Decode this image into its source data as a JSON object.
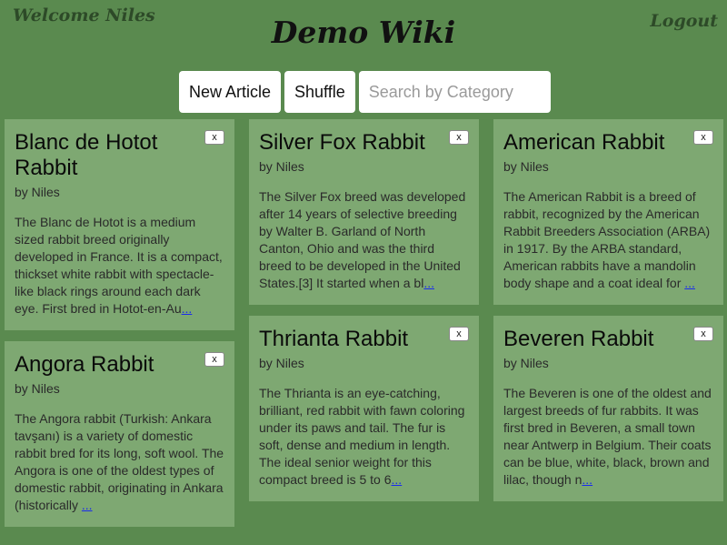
{
  "header": {
    "welcome": "Welcome Niles",
    "title": "Demo Wiki",
    "logout": "Logout"
  },
  "toolbar": {
    "new_article": "New Article",
    "shuffle": "Shuffle",
    "search_placeholder": "Search by Category"
  },
  "cards": [
    {
      "title": "Blanc de Hotot Rabbit",
      "author": "by Niles",
      "excerpt": "The Blanc de Hotot is a medium sized rabbit breed originally developed in France. It is a compact, thickset white rabbit with spectacle-like black rings around each dark eye. First bred in Hotot-en-Au",
      "more": "...",
      "close": "x"
    },
    {
      "title": "Silver Fox Rabbit",
      "author": "by Niles",
      "excerpt": "The Silver Fox breed was developed after 14 years of selective breeding by Walter B. Garland of North Canton, Ohio and was the third breed to be developed in the United States.[3] It started when a bl",
      "more": "...",
      "close": "x"
    },
    {
      "title": "American Rabbit",
      "author": "by Niles",
      "excerpt": "The American Rabbit is a breed of rabbit, recognized by the American Rabbit Breeders Association (ARBA) in 1917. By the ARBA standard, American rabbits have a mandolin body shape and a coat ideal for ",
      "more": "...",
      "close": "x"
    },
    {
      "title": "Angora Rabbit",
      "author": "by Niles",
      "excerpt": "The Angora rabbit (Turkish: Ankara tavşanı) is a variety of domestic rabbit bred for its long, soft wool. The Angora is one of the oldest types of domestic rabbit, originating in Ankara (historically ",
      "more": "...",
      "close": "x"
    },
    {
      "title": "Thrianta Rabbit",
      "author": "by Niles",
      "excerpt": "The Thrianta is an eye-catching, brilliant, red rabbit with fawn coloring under its paws and tail. The fur is soft, dense and medium in length. The ideal senior weight for this compact breed is 5 to 6",
      "more": "...",
      "close": "x"
    },
    {
      "title": "Beveren Rabbit",
      "author": "by Niles",
      "excerpt": "The Beveren is one of the oldest and largest breeds of fur rabbits. It was first bred in Beveren, a small town near Antwerp in Belgium. Their coats can be blue, white, black, brown and lilac, though n",
      "more": "...",
      "close": "x"
    }
  ],
  "colors": {
    "background": "#5a8a4f",
    "card": "#7ea872",
    "link": "#1a2aee"
  }
}
